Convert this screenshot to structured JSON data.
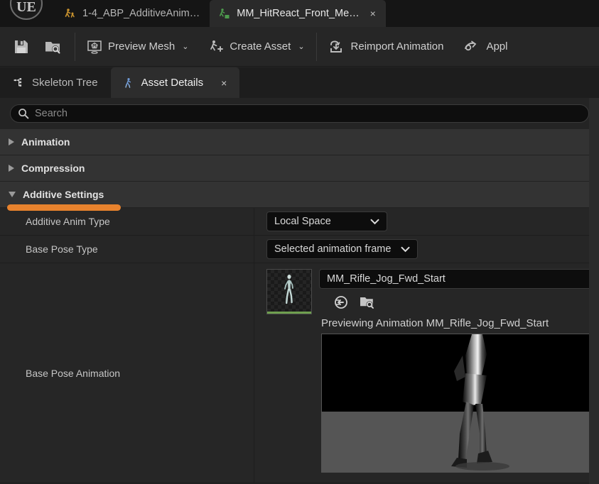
{
  "window": {
    "logo_label": "UE",
    "tabs": [
      {
        "label": "1-4_ABP_AdditiveAnim…",
        "icon": "anim-blueprint-icon",
        "active": false,
        "accent": "#c8922e"
      },
      {
        "label": "MM_HitReact_Front_Me…",
        "icon": "anim-sequence-icon",
        "active": true,
        "accent": "#4d9b4d",
        "close": "×"
      }
    ]
  },
  "toolbar": {
    "save_label": "",
    "browse_label": "",
    "items": [
      {
        "label": "Preview Mesh",
        "icon": "preview-mesh-icon",
        "caret": "⌄"
      },
      {
        "label": "Create Asset",
        "icon": "create-asset-icon",
        "caret": "⌄"
      },
      {
        "label": "Reimport Animation",
        "icon": "reimport-icon",
        "caret": ""
      },
      {
        "label": "Appl",
        "icon": "apply-compression-icon",
        "caret": ""
      }
    ]
  },
  "panel_tabs": [
    {
      "label": "Skeleton Tree",
      "icon": "skeleton-tree-icon",
      "active": false
    },
    {
      "label": "Asset Details",
      "icon": "asset-details-icon",
      "active": true,
      "close": "×"
    }
  ],
  "search": {
    "placeholder": "Search",
    "value": ""
  },
  "categories": [
    {
      "label": "Animation",
      "expanded": false
    },
    {
      "label": "Compression",
      "expanded": false
    },
    {
      "label": "Additive Settings",
      "expanded": true,
      "highlight_color": "#e8822d"
    }
  ],
  "properties": [
    {
      "name": "Additive Anim Type",
      "value": "Local Space"
    },
    {
      "name": "Base Pose Type",
      "value": "Selected animation frame"
    }
  ],
  "base_pose_animation": {
    "name": "Base Pose Animation",
    "asset_value": "MM_Rifle_Jog_Fwd_Start",
    "thumbnail_accent": "#6f9f4f",
    "use_selected_icon": "use-selected-asset-icon",
    "browse_icon": "browse-to-asset-icon",
    "preview_text": "Previewing Animation MM_Rifle_Jog_Fwd_Start"
  },
  "colors": {
    "accent_orange": "#e8822d",
    "panel_bg": "#242424",
    "category_bg": "#333333",
    "row_bg": "#262626",
    "field_bg": "#0d0d0d"
  }
}
